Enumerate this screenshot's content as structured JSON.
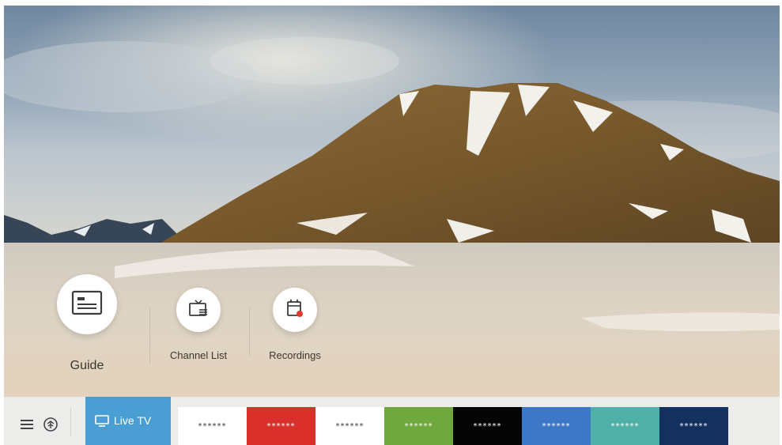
{
  "menu": {
    "guide": {
      "label": "Guide",
      "icon": "guide-icon"
    },
    "channel_list": {
      "label": "Channel List",
      "icon": "channel-list-icon"
    },
    "recordings": {
      "label": "Recordings",
      "icon": "recordings-icon"
    }
  },
  "bottom_bar": {
    "menu_icon": "hamburger-menu-icon",
    "source_icon": "source-icon",
    "live_tv": {
      "label": "Live TV",
      "icon": "tv-icon",
      "color": "#4a9ed3"
    },
    "channels": [
      {
        "text": "******",
        "bg": "#ffffff",
        "fg": "#333333"
      },
      {
        "text": "******",
        "bg": "#d9302b",
        "fg": "#ffffff"
      },
      {
        "text": "******",
        "bg": "#ffffff",
        "fg": "#333333"
      },
      {
        "text": "******",
        "bg": "#6fa83d",
        "fg": "#ffffff"
      },
      {
        "text": "******",
        "bg": "#050505",
        "fg": "#ffffff"
      },
      {
        "text": "******",
        "bg": "#3d78c8",
        "fg": "#ffffff"
      },
      {
        "text": "******",
        "bg": "#4fb0a7",
        "fg": "#ffffff"
      },
      {
        "text": "******",
        "bg": "#14305f",
        "fg": "#ffffff"
      }
    ]
  }
}
